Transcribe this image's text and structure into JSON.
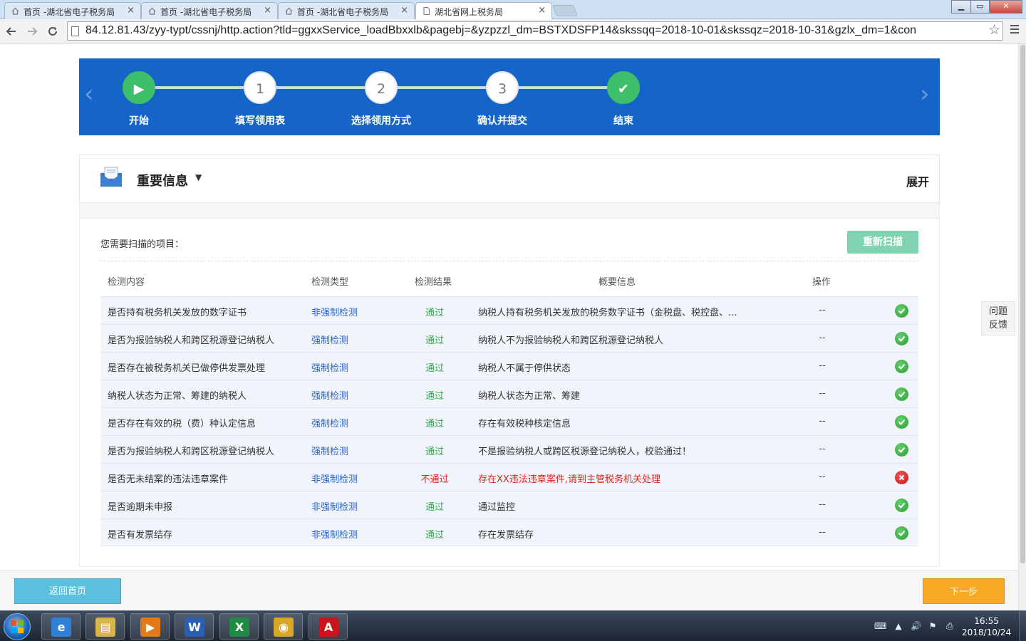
{
  "browser": {
    "tabs": [
      {
        "label": "首页 -湖北省电子税务局",
        "active": false
      },
      {
        "label": "首页 -湖北省电子税务局",
        "active": false
      },
      {
        "label": "首页 -湖北省电子税务局",
        "active": false
      },
      {
        "label": "湖北省网上税务局",
        "active": true
      }
    ],
    "tab_close": "×",
    "url": "84.12.81.43/zyy-typt/cssnj/http.action?tld=ggxxService_loadBbxxlb&pagebj=&yzpzzl_dm=BSTXDSFP14&skssqq=2018-10-01&skssqz=2018-10-31&gzlx_dm=1&con",
    "window_controls": {
      "minimize": "▁",
      "maximize": "▭",
      "close": "✕"
    }
  },
  "steps": {
    "items": [
      {
        "label": "开始",
        "symbol": "▶",
        "state": "done"
      },
      {
        "label": "填写领用表",
        "symbol": "1",
        "state": "pending"
      },
      {
        "label": "选择领用方式",
        "symbol": "2",
        "state": "pending"
      },
      {
        "label": "确认并提交",
        "symbol": "3",
        "state": "pending"
      },
      {
        "label": "结束",
        "symbol": "✔",
        "state": "done"
      }
    ],
    "prev": "‹",
    "next": "›"
  },
  "info": {
    "title": "重要信息",
    "caret": "▼",
    "expand": "展开"
  },
  "scan": {
    "caption": "您需要扫描的项目：",
    "rescan_label": "重新扫描",
    "columns": [
      "检测内容",
      "检测类型",
      "检测结果",
      "概要信息",
      "操作"
    ],
    "rows": [
      {
        "content": "是否持有税务机关发放的数字证书",
        "type": "非强制检测",
        "result": "通过",
        "summary": "纳税人持有税务机关发放的税务数字证书（金税盘、税控盘、...",
        "op": "--",
        "ok": true
      },
      {
        "content": "是否为报验纳税人和跨区税源登记纳税人",
        "type": "强制检测",
        "result": "通过",
        "summary": "纳税人不为报验纳税人和跨区税源登记纳税人",
        "op": "--",
        "ok": true
      },
      {
        "content": "是否存在被税务机关已做停供发票处理",
        "type": "强制检测",
        "result": "通过",
        "summary": "纳税人不属于停供状态",
        "op": "--",
        "ok": true
      },
      {
        "content": "纳税人状态为正常、筹建的纳税人",
        "type": "强制检测",
        "result": "通过",
        "summary": "纳税人状态为正常、筹建",
        "op": "--",
        "ok": true
      },
      {
        "content": "是否存在有效的税（费）种认定信息",
        "type": "强制检测",
        "result": "通过",
        "summary": "存在有效税种核定信息",
        "op": "--",
        "ok": true
      },
      {
        "content": "是否为报验纳税人和跨区税源登记纳税人",
        "type": "强制检测",
        "result": "通过",
        "summary": "不是报验纳税人或跨区税源登记纳税人，校验通过！",
        "op": "--",
        "ok": true
      },
      {
        "content": "是否无未结案的违法违章案件",
        "type": "非强制检测",
        "result": "不通过",
        "summary": "存在XX违法违章案件,请到主管税务机关处理",
        "op": "--",
        "ok": false
      },
      {
        "content": "是否逾期未申报",
        "type": "非强制检测",
        "result": "通过",
        "summary": "通过监控",
        "op": "--",
        "ok": true
      },
      {
        "content": "是否有发票结存",
        "type": "非强制检测",
        "result": "通过",
        "summary": "存在发票结存",
        "op": "--",
        "ok": true
      }
    ]
  },
  "feedback": {
    "line1": "问题",
    "line2": "反馈"
  },
  "footer": {
    "home_label": "返回首页",
    "next_label": "下一步"
  },
  "taskbar": {
    "apps": [
      {
        "name": "ie",
        "glyph": "e",
        "color": "#2f7fd6"
      },
      {
        "name": "explorer",
        "glyph": "▤",
        "color": "#d9b44a"
      },
      {
        "name": "media",
        "glyph": "▶",
        "color": "#e07a1a"
      },
      {
        "name": "word",
        "glyph": "W",
        "color": "#2b5fb3"
      },
      {
        "name": "excel",
        "glyph": "X",
        "color": "#1f8a43"
      },
      {
        "name": "chrome",
        "glyph": "◉",
        "color": "#d8a629"
      },
      {
        "name": "acrobat",
        "glyph": "A",
        "color": "#c8161d"
      }
    ],
    "time": "16:55",
    "date": "2018/10/24"
  },
  "colors": {
    "steps_bg": "#1565c8",
    "pass": "#35a64f",
    "fail": "#e0241b",
    "type_link": "#2a62c8",
    "rescan": "#7fd3b0",
    "home": "#5bc0de",
    "next": "#f7a824"
  }
}
